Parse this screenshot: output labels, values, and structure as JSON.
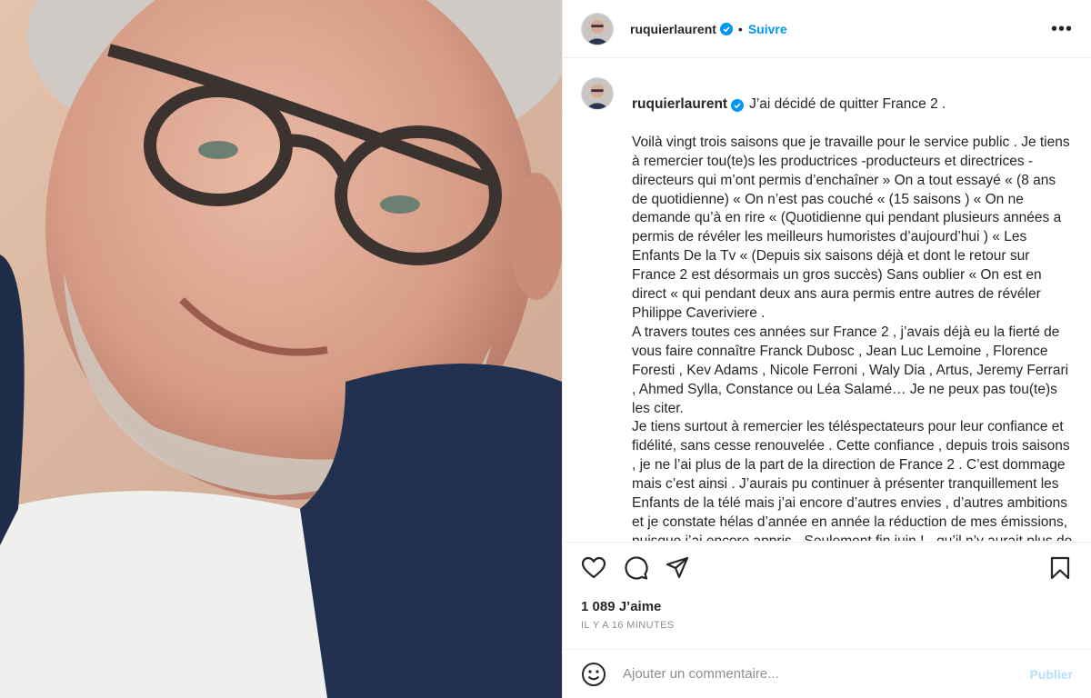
{
  "post": {
    "username": "ruquierlaurent",
    "follow_label": "Suivre",
    "dot": "•",
    "more_label": "•••",
    "verified_icon": "verified-badge-icon",
    "caption_first_line": "J’ai décidé de quitter France 2 .",
    "caption_body": "Voilà vingt trois saisons que je travaille pour le service public . Je tiens à remercier tou(te)s les productrices -producteurs et directrices -directeurs qui m’ont permis d’enchaîner » On a tout essayé «  (8 ans de quotidienne) «  On n’est pas couché «  (15 saisons ) « On ne demande qu’à en rire « (Quotidienne qui pendant plusieurs années a permis de révéler les meilleurs humoristes d’aujourd’hui ) « Les Enfants De la Tv «  (Depuis six saisons déjà et dont le retour sur France 2 est désormais un gros succès) Sans oublier «  On est en direct « qui pendant deux ans aura permis entre autres de révéler Philippe Caveriviere .\nA travers toutes ces années sur France 2 , j’avais déjà eu la fierté de vous faire connaître Franck Dubosc , Jean Luc Lemoine , Florence Foresti , Kev Adams , Nicole Ferroni , Waly Dia , Artus, Jeremy Ferrari , Ahmed Sylla, Constance ou Léa Salamé… Je ne peux pas tou(te)s les citer.\nJe tiens surtout à remercier les téléspectateurs pour leur confiance et fidélité, sans cesse renouvelée . Cette confiance , depuis trois saisons , je ne l’ai plus de la part de la direction de France 2 . C’est dommage mais c’est ainsi . J’aurais pu continuer à présenter tranquillement les Enfants de la télé mais j’ai encore d’autres envies , d’autres ambitions et je constate hélas d’année en année la réduction de mes émissions, puisque j’ai encore appris - Seulement fin juin ! - qu’il n’y aurait plus de prime des",
    "likes": "1 089 J’aime",
    "time_ago": "IL Y A 16 MINUTES"
  },
  "comment_box": {
    "placeholder": "Ajouter un commentaire...",
    "publish_label": "Publier"
  },
  "colors": {
    "accent": "#0095f6",
    "publish_disabled": "#b2dffc",
    "muted": "#8e8e8e",
    "text": "#262626"
  },
  "icons": {
    "like": "heart-icon",
    "comment": "comment-icon",
    "share": "paper-plane-icon",
    "save": "bookmark-icon",
    "emoji": "smiley-icon",
    "more": "more-options-icon"
  }
}
